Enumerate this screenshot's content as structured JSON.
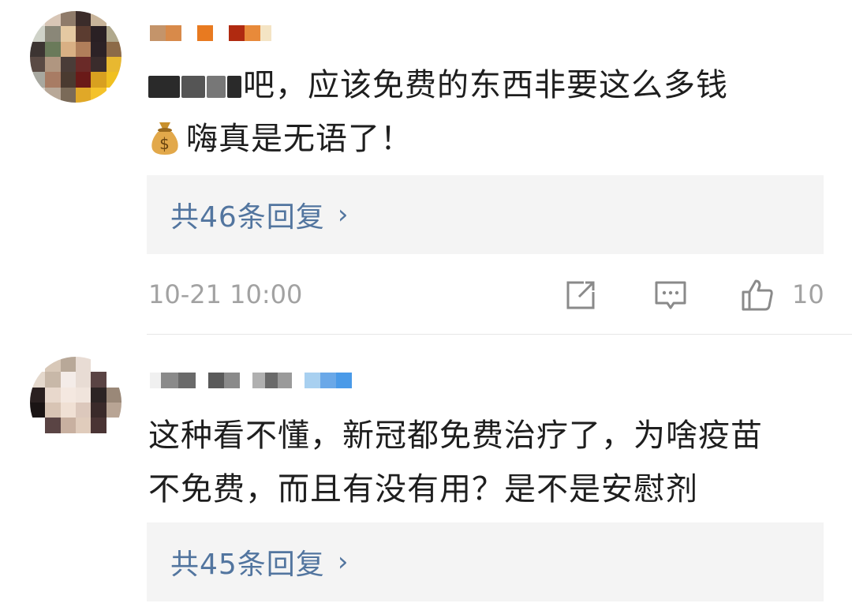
{
  "comments": [
    {
      "text_lines": [
        "吧，应该免费的东西非要这么多钱",
        "嗨真是无语了！"
      ],
      "emoji": "money-bag",
      "reply_label": "共46条回复",
      "reply_chevron": "›",
      "timestamp": "10-21 10:00",
      "like_count": "10"
    },
    {
      "text_lines": [
        "这种看不懂，新冠都免费治疗了，为啥疫苗",
        "不免费，而且有没有用？是不是安慰剂"
      ],
      "reply_label": "共45条回复",
      "reply_chevron": "›"
    }
  ],
  "icons": {
    "share": "share-icon",
    "comment": "comment-icon",
    "like": "thumbs-up-icon"
  },
  "colors": {
    "link": "#52759f",
    "muted": "#a2a2a2",
    "reply_bg": "#f4f4f4"
  }
}
